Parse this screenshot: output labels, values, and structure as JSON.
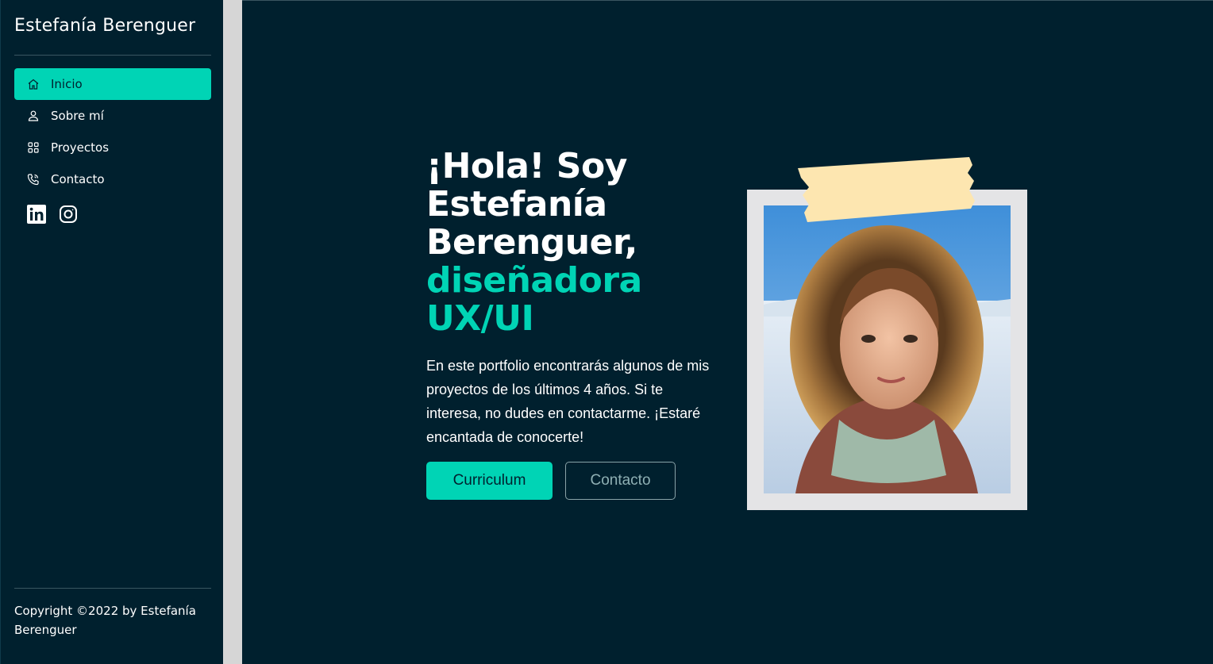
{
  "sidebar": {
    "brand": "Estefanía Berenguer",
    "nav": [
      {
        "label": "Inicio",
        "icon": "home-icon",
        "active": true
      },
      {
        "label": "Sobre mí",
        "icon": "user-icon",
        "active": false
      },
      {
        "label": "Proyectos",
        "icon": "grid-icon",
        "active": false
      },
      {
        "label": "Contacto",
        "icon": "phone-icon",
        "active": false
      }
    ],
    "socials": [
      {
        "icon": "linkedin-icon"
      },
      {
        "icon": "instagram-icon"
      }
    ],
    "copyright_line1": "Copyright ©2022 by Estefanía",
    "copyright_line2": "Berenguer"
  },
  "hero": {
    "headline_1": "¡Hola! Soy",
    "headline_2": "Estefanía",
    "headline_3": "Berenguer,",
    "headline_accent_1": "diseñadora",
    "headline_accent_2": "UX/UI",
    "intro": "En este portfolio encontrarás algunos de mis proyectos de los últimos 4 años. Si te interesa, no dudes en contactarme. ¡Estaré encantada de conocerte!",
    "primary_button": "Curriculum",
    "secondary_button": "Contacto"
  },
  "colors": {
    "background": "#00202e",
    "accent": "#00d4b5",
    "tape": "#fde6b0",
    "frame": "#e4e4e6"
  }
}
